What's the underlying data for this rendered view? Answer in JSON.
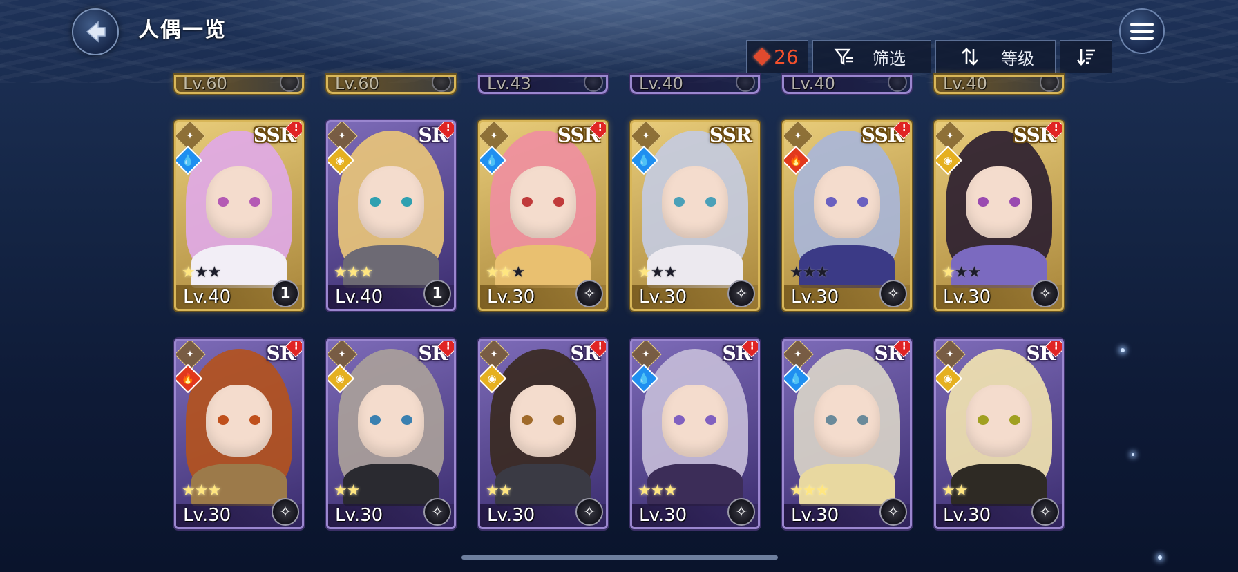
{
  "header": {
    "title": "人偶一览",
    "back_icon": "back-arrow-icon",
    "menu_icon": "hamburger-menu-icon"
  },
  "toolbar": {
    "count": "26",
    "filter_label": "筛选",
    "sort_label": "等级",
    "colors": {
      "count": "#f2502c",
      "gem": "#e04a2e"
    }
  },
  "partial_row": [
    {
      "level": "Lv.60",
      "rarity": "ssr"
    },
    {
      "level": "Lv.60",
      "rarity": "ssr"
    },
    {
      "level": "Lv.43",
      "rarity": "sr"
    },
    {
      "level": "Lv.40",
      "rarity": "sr"
    },
    {
      "level": "Lv.40",
      "rarity": "sr"
    },
    {
      "level": "Lv.40",
      "rarity": "ssr"
    }
  ],
  "cards": [
    {
      "rarity": "SSR",
      "frame": "ssr",
      "element": "water",
      "element_icon": "water-drop-icon",
      "stars": 3,
      "stars_on": 1,
      "level": "Lv.40",
      "emblem": "1",
      "alert": "!",
      "palette": {
        "hair": "#e0a9e6",
        "body": "#f2eef6",
        "eye": "#b45ab4"
      }
    },
    {
      "rarity": "SR",
      "frame": "sr",
      "element": "light",
      "element_icon": "light-icon",
      "stars": 3,
      "stars_on": 3,
      "level": "Lv.40",
      "emblem": "1",
      "alert": "!",
      "palette": {
        "hair": "#e8c47a",
        "body": "#6d6a74",
        "eye": "#2fa0b0"
      }
    },
    {
      "rarity": "SSR",
      "frame": "ssr",
      "element": "water",
      "element_icon": "water-drop-icon",
      "stars": 3,
      "stars_on": 2,
      "level": "Lv.30",
      "emblem": "",
      "alert": "!",
      "palette": {
        "hair": "#ef8fa0",
        "body": "#e9c070",
        "eye": "#c03a3a"
      }
    },
    {
      "rarity": "SSR",
      "frame": "ssr",
      "element": "water",
      "element_icon": "water-drop-icon",
      "stars": 3,
      "stars_on": 1,
      "level": "Lv.30",
      "emblem": "",
      "alert": "",
      "palette": {
        "hair": "#c4cbe0",
        "body": "#ece9ef",
        "eye": "#4aa0b8"
      }
    },
    {
      "rarity": "SSR",
      "frame": "ssr",
      "element": "fire",
      "element_icon": "fire-icon",
      "stars": 3,
      "stars_on": 0,
      "level": "Lv.30",
      "emblem": "",
      "alert": "!",
      "palette": {
        "hair": "#a9b6d8",
        "body": "#3b3a86",
        "eye": "#6a60c0"
      }
    },
    {
      "rarity": "SSR",
      "frame": "ssr",
      "element": "light",
      "element_icon": "light-icon",
      "stars": 3,
      "stars_on": 1,
      "level": "Lv.30",
      "emblem": "",
      "alert": "!",
      "palette": {
        "hair": "#2c2030",
        "body": "#7b6ac0",
        "eye": "#9a4ab0"
      }
    },
    {
      "rarity": "SR",
      "frame": "sr",
      "element": "fire",
      "element_icon": "fire-icon",
      "stars": 3,
      "stars_on": 3,
      "level": "Lv.30",
      "emblem": "",
      "alert": "!",
      "palette": {
        "hair": "#b3521e",
        "body": "#9c7a4a",
        "eye": "#c0501c"
      }
    },
    {
      "rarity": "SR",
      "frame": "sr",
      "element": "light",
      "element_icon": "light-icon",
      "stars": 2,
      "stars_on": 2,
      "level": "Lv.30",
      "emblem": "",
      "alert": "!",
      "palette": {
        "hair": "#a9a09a",
        "body": "#2a2a30",
        "eye": "#3a80b0"
      }
    },
    {
      "rarity": "SR",
      "frame": "sr",
      "element": "light",
      "element_icon": "light-icon",
      "stars": 2,
      "stars_on": 2,
      "level": "Lv.30",
      "emblem": "",
      "alert": "!",
      "palette": {
        "hair": "#3a2a22",
        "body": "#3a3a44",
        "eye": "#a06a2a"
      }
    },
    {
      "rarity": "SR",
      "frame": "sr",
      "element": "water",
      "element_icon": "water-drop-icon",
      "stars": 3,
      "stars_on": 3,
      "level": "Lv.30",
      "emblem": "",
      "alert": "!",
      "palette": {
        "hair": "#c4bcd8",
        "body": "#3c2d58",
        "eye": "#8060c0"
      }
    },
    {
      "rarity": "SR",
      "frame": "sr",
      "element": "water",
      "element_icon": "water-drop-icon",
      "stars": 3,
      "stars_on": 3,
      "level": "Lv.30",
      "emblem": "",
      "alert": "!",
      "palette": {
        "hair": "#d8d2c8",
        "body": "#e8d8a0",
        "eye": "#6a8a9a"
      }
    },
    {
      "rarity": "SR",
      "frame": "sr",
      "element": "light",
      "element_icon": "light-icon",
      "stars": 2,
      "stars_on": 2,
      "level": "Lv.30",
      "emblem": "",
      "alert": "!",
      "palette": {
        "hair": "#f0e2b0",
        "body": "#2e2a24",
        "eye": "#a0a020"
      }
    }
  ]
}
